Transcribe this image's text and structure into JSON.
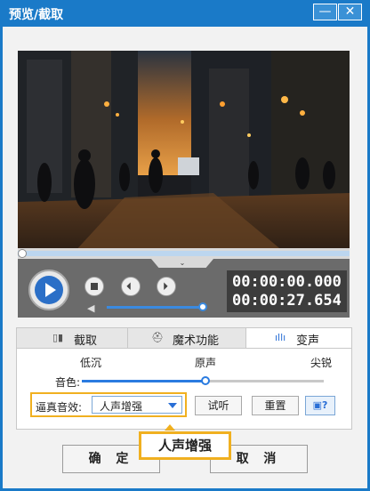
{
  "window": {
    "title": "预览/截取",
    "minimize": "—",
    "close": "✕"
  },
  "player": {
    "current_time": "00:00:00.000",
    "total_time": "00:00:27.654",
    "seek_fraction": 0.0,
    "volume_fraction": 1.0
  },
  "tabs": [
    {
      "label": "截取",
      "icon": "crop-icon"
    },
    {
      "label": "魔术功能",
      "icon": "magic-hat-icon"
    },
    {
      "label": "变声",
      "icon": "waveform-icon",
      "active": true
    }
  ],
  "voice": {
    "levels": [
      "低沉",
      "原声",
      "尖锐"
    ],
    "pitch_label": "音色:",
    "pitch_fraction": 0.5,
    "effect_label": "逼真音效:",
    "effect_value": "人声增强",
    "listen_button": "试听",
    "reset_button": "重置"
  },
  "buttons": {
    "ok": "确 定",
    "cancel": "取 消"
  },
  "tooltip": "人声增强",
  "colors": {
    "titlebar": "#1a7ac8",
    "accent": "#2a7be0",
    "highlight": "#f0b020"
  }
}
